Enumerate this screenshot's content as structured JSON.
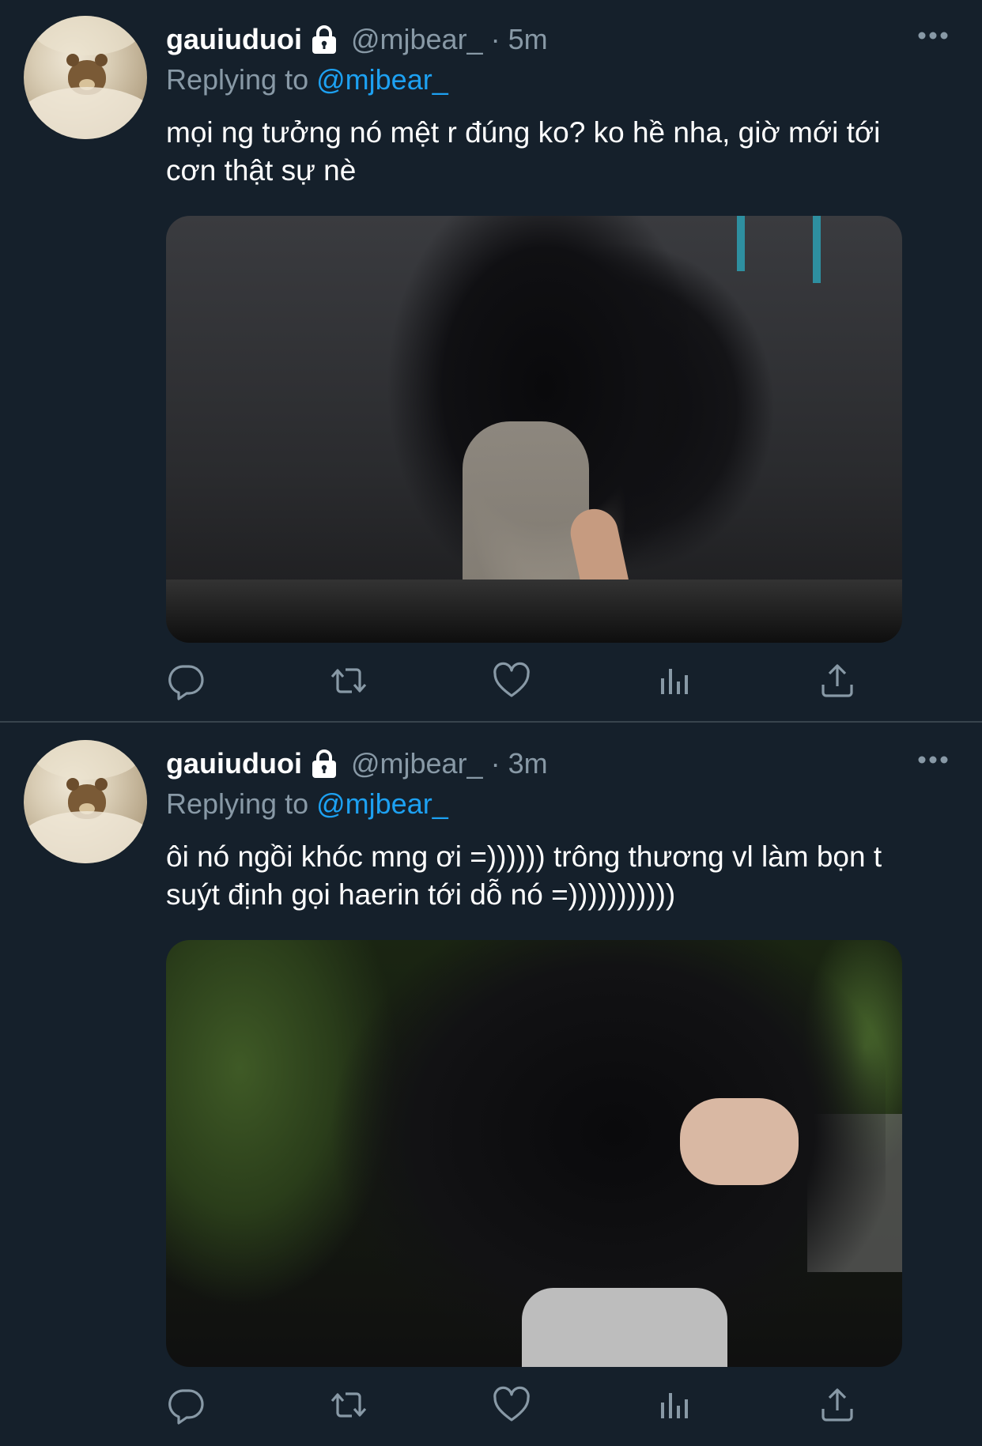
{
  "tweets": [
    {
      "display_name": "gauiuduoi",
      "handle": "@mjbear_",
      "separator": "·",
      "time": "5m",
      "replying_prefix": "Replying to",
      "replying_to": "@mjbear_",
      "text": "mọi ng tưởng nó mệt r đúng ko? ko hề nha, giờ mới tới cơn thật sự nè"
    },
    {
      "display_name": "gauiuduoi",
      "handle": "@mjbear_",
      "separator": "·",
      "time": "3m",
      "replying_prefix": "Replying to",
      "replying_to": "@mjbear_",
      "text": "ôi nó ngồi khóc mng ơi =)))))) trông thương vl làm bọn t suýt định gọi haerin tới dỗ nó =)))))))))))"
    }
  ],
  "icons": {
    "more": "more-horizontal-icon",
    "lock": "lock-icon",
    "reply": "reply-icon",
    "retweet": "retweet-icon",
    "like": "heart-icon",
    "stats": "analytics-icon",
    "share": "share-icon"
  },
  "colors": {
    "background": "#15202b",
    "text": "#ffffff",
    "secondary": "#8899a6",
    "link": "#1da1f2",
    "divider": "#38444d"
  }
}
